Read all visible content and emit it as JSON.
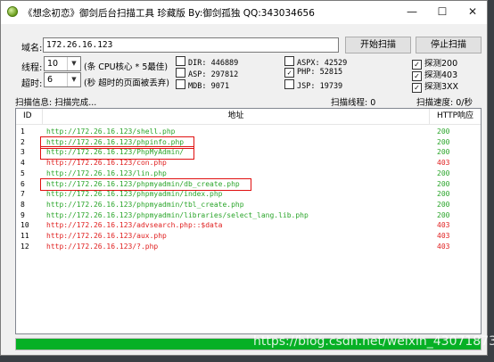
{
  "window": {
    "title": "《想念初恋》御剑后台扫描工具 珍藏版 By:御剑孤独 QQ:343034656",
    "minimize": "—",
    "maximize": "☐",
    "close": "✕"
  },
  "form": {
    "domain_label": "域名:",
    "domain_value": "172.26.16.123",
    "threads_label": "线程:",
    "threads_value": "10",
    "threads_hint": "(条 CPU核心 * 5最佳)",
    "timeout_label": "超时:",
    "timeout_value": "6",
    "timeout_hint": "(秒 超时的页面被丢弃)",
    "start_button": "开始扫描",
    "stop_button": "停止扫描"
  },
  "dictionaries": [
    {
      "label": "DIR: 446889",
      "checked": false
    },
    {
      "label": "ASP: 297812",
      "checked": false
    },
    {
      "label": "MDB: 9071",
      "checked": false
    },
    {
      "label": "ASPX: 42529",
      "checked": false
    },
    {
      "label": "PHP: 52815",
      "checked": true
    },
    {
      "label": "JSP: 19739",
      "checked": false
    },
    {
      "label": "探测200",
      "checked": true
    },
    {
      "label": "探测403",
      "checked": true
    },
    {
      "label": "探测3XX",
      "checked": true
    }
  ],
  "status": {
    "scan_info": "扫描信息: 扫描完成...",
    "scan_threads": "扫描线程: 0",
    "scan_speed": "扫描速度: 0/秒"
  },
  "table": {
    "headers": [
      "ID",
      "地址",
      "HTTP响应"
    ],
    "rows": [
      {
        "id": "1",
        "url": "http://172.26.16.123/shell.php",
        "code": "200",
        "status": "ok",
        "highlighted": false
      },
      {
        "id": "2",
        "url": "http://172.26.16.123/phpinfo.php",
        "code": "200",
        "status": "ok",
        "highlighted": true
      },
      {
        "id": "3",
        "url": "http://172.26.16.123/PhpMyAdmin/",
        "code": "200",
        "status": "ok",
        "highlighted": true
      },
      {
        "id": "4",
        "url": "http://172.26.16.123/con.php",
        "code": "403",
        "status": "forbidden",
        "highlighted": false
      },
      {
        "id": "5",
        "url": "http://172.26.16.123/lin.php",
        "code": "200",
        "status": "ok",
        "highlighted": false
      },
      {
        "id": "6",
        "url": "http://172.26.16.123/phpmyadmin/db_create.php",
        "code": "200",
        "status": "ok",
        "highlighted": true
      },
      {
        "id": "7",
        "url": "http://172.26.16.123/phpmyadmin/index.php",
        "code": "200",
        "status": "ok",
        "highlighted": false
      },
      {
        "id": "8",
        "url": "http://172.26.16.123/phpmyadmin/tbl_create.php",
        "code": "200",
        "status": "ok",
        "highlighted": false
      },
      {
        "id": "9",
        "url": "http://172.26.16.123/phpmyadmin/libraries/select_lang.lib.php",
        "code": "200",
        "status": "ok",
        "highlighted": false
      },
      {
        "id": "10",
        "url": "http://172.26.16.123/advsearch.php::$data",
        "code": "403",
        "status": "forbidden",
        "highlighted": false
      },
      {
        "id": "11",
        "url": "http://172.26.16.123/aux.php",
        "code": "403",
        "status": "forbidden",
        "highlighted": false
      },
      {
        "id": "12",
        "url": "http://172.26.16.123/?.php",
        "code": "403",
        "status": "forbidden",
        "highlighted": false
      }
    ]
  },
  "progress": {
    "value": 1.0
  },
  "watermark": "https://blog.csdn.net/weixin_43071873",
  "colors": {
    "ok": "#2aa52a",
    "forbidden": "#e02020",
    "progress": "#06b025",
    "annotation": "#e01010"
  }
}
